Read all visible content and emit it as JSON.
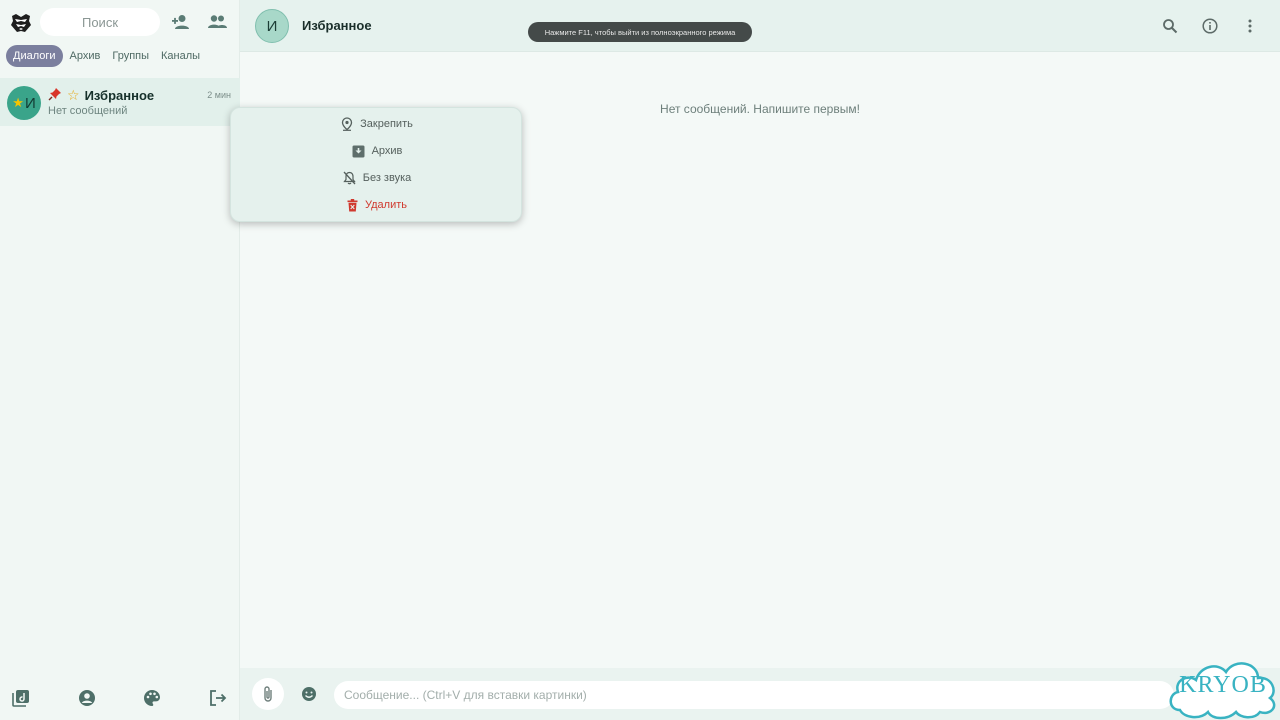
{
  "sidebar": {
    "search": {
      "placeholder": "Поиск"
    },
    "tabs": [
      {
        "label": "Диалоги",
        "active": true
      },
      {
        "label": "Архив",
        "active": false
      },
      {
        "label": "Группы",
        "active": false
      },
      {
        "label": "Каналы",
        "active": false
      }
    ],
    "chats": [
      {
        "avatar_letter": "И",
        "pin_icon": "pushpin-emoji",
        "star_icon": "star-emoji",
        "name": "Избранное",
        "time": "2 мин",
        "preview": "Нет сообщений"
      }
    ],
    "bottom_icons": [
      "stories-icon",
      "profile-icon",
      "palette-icon",
      "logout-icon"
    ],
    "top_icons": [
      "add-contact-icon",
      "contacts-icon"
    ]
  },
  "header": {
    "avatar_letter": "И",
    "title": "Избранное",
    "icons": [
      "search-icon",
      "info-icon",
      "more-vertical-icon"
    ]
  },
  "fullscreen_toast": "Нажмите F11, чтобы выйти из полноэкранного режима",
  "main": {
    "empty_message": "Нет сообщений. Напишите первым!"
  },
  "composer": {
    "placeholder": "Сообщение... (Ctrl+V для вставки картинки)"
  },
  "context_menu": {
    "items": [
      {
        "label": "Закрепить",
        "icon": "pin-location-icon"
      },
      {
        "label": "Архив",
        "icon": "archive-icon"
      },
      {
        "label": "Без звука",
        "icon": "bell-off-icon"
      },
      {
        "label": "Удалить",
        "icon": "trash-icon",
        "danger": true
      }
    ]
  },
  "watermark": {
    "text": "KRYOB"
  },
  "colors": {
    "accent": "#3aa48a",
    "tab_active": "#7b7f9e",
    "danger": "#d0392e"
  }
}
